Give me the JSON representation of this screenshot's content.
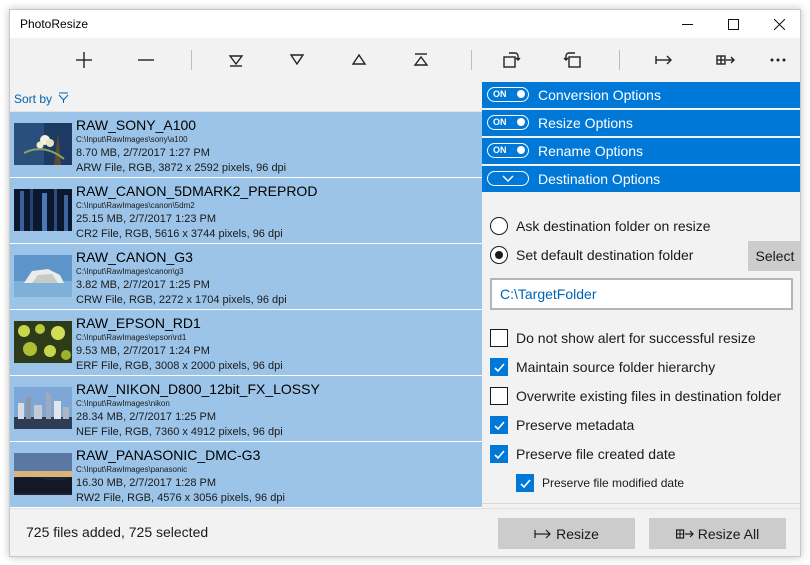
{
  "app": {
    "title": "PhotoResize"
  },
  "toolbar": {
    "buttons": [
      "add-icon",
      "remove-icon",
      "move-bottom-icon",
      "move-down-icon",
      "move-up-icon",
      "move-top-icon",
      "rotate-left-icon",
      "rotate-right-icon",
      "resize-icon",
      "resize-all-icon",
      "more-icon"
    ]
  },
  "sort": {
    "label": "Sort by"
  },
  "files": [
    {
      "name": "RAW_SONY_A100",
      "path": "C:\\Input\\RawImages\\sony\\a100",
      "size": "8.70 MB, 2/7/2017 1:27 PM",
      "info": "ARW File, RGB, 3872 x 2592 pixels, 96 dpi"
    },
    {
      "name": "RAW_CANON_5DMARK2_PREPROD",
      "path": "C:\\Input\\RawImages\\canon\\5dm2",
      "size": "25.15 MB, 2/7/2017 1:23 PM",
      "info": "CR2 File, RGB, 5616 x 3744 pixels, 96 dpi"
    },
    {
      "name": "RAW_CANON_G3",
      "path": "C:\\Input\\RawImages\\canon\\g3",
      "size": "3.82 MB, 2/7/2017 1:25 PM",
      "info": "CRW File, RGB, 2272 x 1704 pixels, 96 dpi"
    },
    {
      "name": "RAW_EPSON_RD1",
      "path": "C:\\Input\\RawImages\\epson\\rd1",
      "size": "9.53 MB, 2/7/2017 1:24 PM",
      "info": "ERF File, RGB, 3008 x 2000 pixels, 96 dpi"
    },
    {
      "name": "RAW_NIKON_D800_12bit_FX_LOSSY",
      "path": "C:\\Input\\RawImages\\nikon",
      "size": "28.34 MB, 2/7/2017 1:25 PM",
      "info": "NEF File, RGB, 7360 x 4912 pixels, 96 dpi"
    },
    {
      "name": "RAW_PANASONIC_DMC-G3",
      "path": "C:\\Input\\RawImages\\panasonic",
      "size": "16.30 MB, 2/7/2017 1:28 PM",
      "info": "RW2 File, RGB, 4576 x 3056 pixels, 96 dpi"
    }
  ],
  "panels": {
    "conversion": {
      "label": "Conversion Options",
      "toggle": "ON"
    },
    "resize": {
      "label": "Resize Options",
      "toggle": "ON"
    },
    "rename": {
      "label": "Rename Options",
      "toggle": "ON"
    },
    "destination": {
      "label": "Destination Options"
    }
  },
  "destination": {
    "ask_label": "Ask destination folder on resize",
    "set_label": "Set default destination folder",
    "select_label": "Select",
    "folder_value": "C:\\TargetFolder",
    "options": [
      {
        "label": "Do not show alert for successful resize",
        "checked": false
      },
      {
        "label": "Maintain source folder hierarchy",
        "checked": true
      },
      {
        "label": "Overwrite existing files in destination folder",
        "checked": false
      },
      {
        "label": "Preserve metadata",
        "checked": true
      },
      {
        "label": "Preserve file created date",
        "checked": true
      },
      {
        "label": "Preserve file modified date",
        "checked": true
      }
    ]
  },
  "status": {
    "text": "725 files added, 725 selected",
    "resize_label": "Resize",
    "resize_all_label": "Resize All"
  },
  "colors": {
    "accent": "#0078d7",
    "selection": "#9cc4e8",
    "button": "#cccccc",
    "link": "#0063b1"
  }
}
